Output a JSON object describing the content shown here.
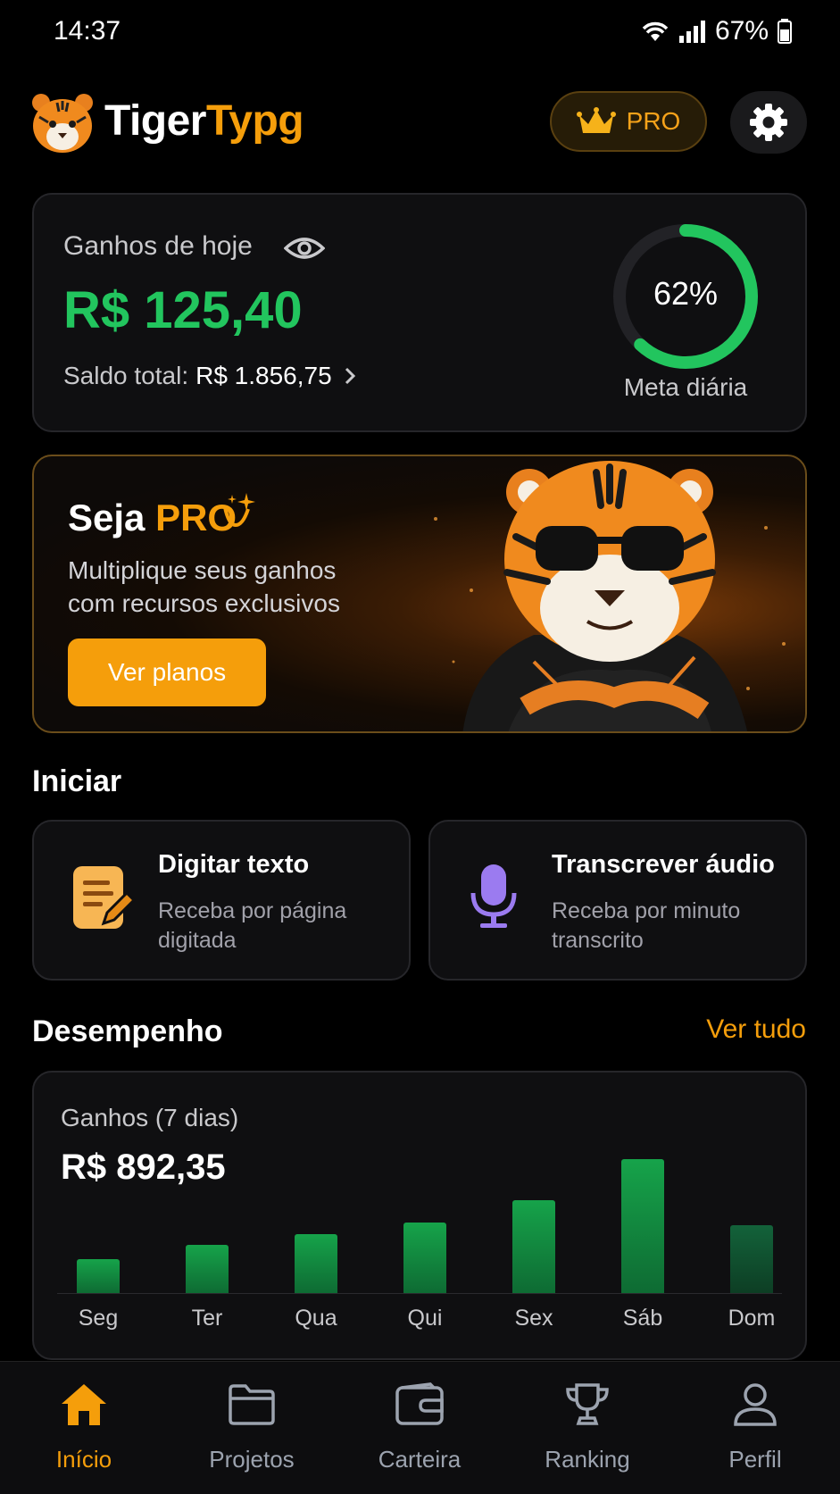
{
  "status_bar": {
    "time": "14:37",
    "battery": "67%"
  },
  "header": {
    "logo_a": "Tiger",
    "logo_b": "Typg",
    "pro_label": "PRO"
  },
  "earnings": {
    "label": "Ganhos de hoje",
    "amount": "R$ 125,40",
    "balance_label": "Saldo total:",
    "balance_value": "R$ 1.856,75",
    "goal_percent": "62%",
    "goal_fraction": 0.62,
    "goal_label": "Meta diária"
  },
  "promo": {
    "title_a": "Seja",
    "title_b": "PRO",
    "subtitle_line1": "Multiplique seus ganhos",
    "subtitle_line2": "com recursos exclusivos",
    "button": "Ver planos"
  },
  "start": {
    "title": "Iniciar",
    "type_title": "Digitar texto",
    "type_sub_1": "Receba por página",
    "type_sub_2": "digitada",
    "audio_title": "Transcrever áudio",
    "audio_sub_1": "Receba por minuto",
    "audio_sub_2": "transcrito"
  },
  "performance": {
    "title": "Desempenho",
    "see_all": "Ver tudo",
    "label": "Ganhos (7 dias)",
    "total": "R$ 892,35"
  },
  "chart_data": {
    "type": "bar",
    "categories": [
      "Seg",
      "Ter",
      "Qua",
      "Qui",
      "Sex",
      "Sáb",
      "Dom"
    ],
    "values": [
      38,
      54,
      66,
      79,
      104,
      150,
      76
    ],
    "title": "Ganhos (7 dias)",
    "grid": false
  },
  "nav": {
    "home": "Início",
    "projects": "Projetos",
    "wallet": "Carteira",
    "ranking": "Ranking",
    "profile": "Perfil"
  },
  "colors": {
    "accent": "#f59e0b",
    "success": "#22c55e",
    "background": "#000000"
  },
  "icons": [
    "wifi-icon",
    "signal-icon",
    "battery-icon",
    "tiger-logo-icon",
    "crown-icon",
    "gear-icon",
    "eye-icon",
    "chevron-right-icon",
    "sparkle-icon",
    "document-edit-icon",
    "microphone-icon",
    "home-icon",
    "folder-icon",
    "wallet-icon",
    "trophy-icon",
    "user-icon"
  ]
}
